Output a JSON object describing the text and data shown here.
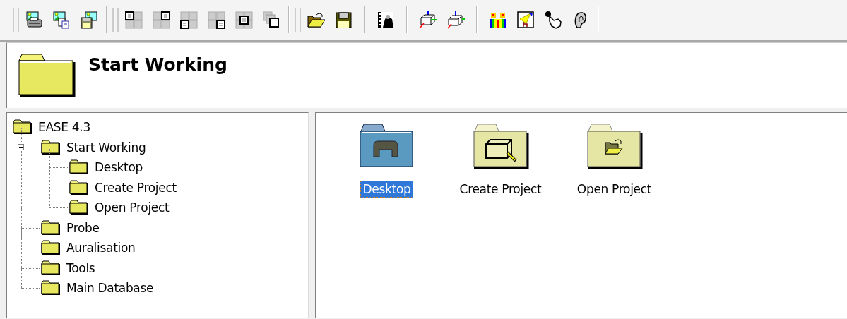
{
  "header": {
    "title": "Start Working"
  },
  "tree": [
    {
      "label": "EASE 4.3",
      "children": [
        {
          "label": "Start Working",
          "expanded": true,
          "children": [
            {
              "label": "Desktop"
            },
            {
              "label": "Create Project"
            },
            {
              "label": "Open Project"
            }
          ]
        },
        {
          "label": "Probe"
        },
        {
          "label": "Auralisation"
        },
        {
          "label": "Tools"
        },
        {
          "label": "Main Database"
        }
      ]
    }
  ],
  "items": [
    {
      "label": "Desktop",
      "kind": "desktop",
      "selected": true
    },
    {
      "label": "Create Project",
      "kind": "create",
      "selected": false
    },
    {
      "label": "Open Project",
      "kind": "open",
      "selected": false
    }
  ]
}
